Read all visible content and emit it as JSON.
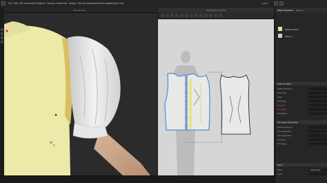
{
  "menu": {
    "items": [
      "File",
      "Edit",
      "3D Garment",
      "2D Pattern",
      "Sewing",
      "Materials",
      "Avatar",
      "Render",
      "Display",
      "Preferences",
      "Settings",
      "Help"
    ],
    "user": "julie.l"
  },
  "viewport3d": {
    "title": "3D Garment"
  },
  "viewport2d": {
    "title": "2D Pattern Window"
  },
  "right_panel": {
    "tabs": [
      "Object Browser",
      "Library"
    ],
    "objects": [
      {
        "label": "Default Fabric"
      },
      {
        "label": "Fabric 1"
      }
    ],
    "property_header": "Property Editor",
    "properties": [
      {
        "label": "Particle Distance",
        "value": "",
        "red": false
      },
      {
        "label": "Mesh Type",
        "value": "",
        "red": false
      },
      {
        "label": "Layer",
        "value": "",
        "red": false
      },
      {
        "label": "Thickness",
        "value": "",
        "red": false
      },
      {
        "label": "Pressure",
        "value": "",
        "red": true
      },
      {
        "label": "Shrinkage",
        "value": "",
        "red": true
      },
      {
        "label": "Strengthen",
        "value": "",
        "red": false
      }
    ],
    "sim_header": "Simulation Properties",
    "sim_properties": [
      {
        "label": "Particle Distance",
        "value": ""
      },
      {
        "label": "Shrinkage-Weft",
        "value": ""
      },
      {
        "label": "Shrinkage-Warp",
        "value": ""
      },
      {
        "label": "Pressure",
        "value": ""
      },
      {
        "label": "Thickness",
        "value": ""
      }
    ],
    "fabric_header": "Fabric",
    "fabric_rows": [
      {
        "label": "Fabric",
        "value": "Default Fab"
      },
      {
        "label": "Layer",
        "value": ""
      }
    ]
  },
  "colors": {
    "fabric_yellow": "#ece9a9",
    "trim_gold": "#d8bf60",
    "seam_blue": "#4a8fd6",
    "seam_yellow": "#e7e04a",
    "selection_red": "#d9434f",
    "avatar_grey": "#bcbcbc"
  }
}
